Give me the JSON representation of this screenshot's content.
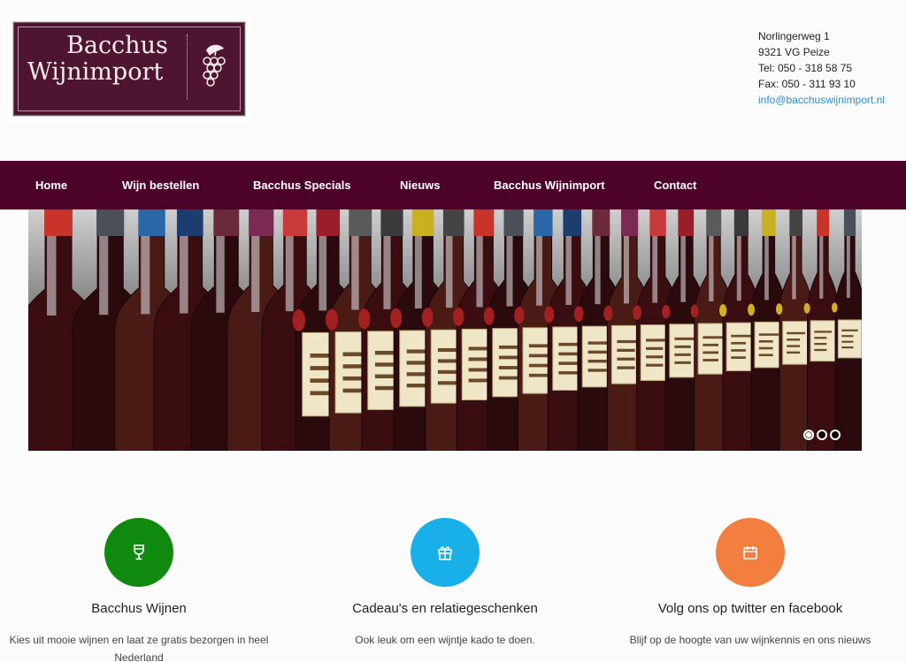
{
  "header": {
    "logo": {
      "line1": "Bacchus",
      "line2": "Wijnimport",
      "bg_color": "#4f1530"
    },
    "contact": {
      "street": "Norlingerweg 1",
      "city": "9321 VG Peize",
      "tel": "Tel: 050 - 318 58 75",
      "fax": "Fax: 050 - 311 93 10",
      "email": "info@bacchuswijnimport.nl"
    }
  },
  "nav": {
    "bg_color": "#4c0229",
    "items": [
      {
        "label": "Home"
      },
      {
        "label": "Wijn bestellen"
      },
      {
        "label": "Bacchus Specials"
      },
      {
        "label": "Nieuws"
      },
      {
        "label": "Bacchus Wijnimport"
      },
      {
        "label": "Contact"
      }
    ]
  },
  "slider": {
    "image_subject": "row of wine bottles with labels",
    "slide_count": 3,
    "active_slide": 1
  },
  "features": [
    {
      "title": "Bacchus Wijnen",
      "text": "Kies uit mooie wijnen en laat ze gratis bezorgen in heel Nederland",
      "icon": "wine-glass-icon",
      "color": "#0f8a0f"
    },
    {
      "title": "Cadeau's en relatiegeschenken",
      "text": "Ook leuk om een wijntje kado te doen.",
      "icon": "gift-icon",
      "color": "#19b0ea"
    },
    {
      "title": "Volg ons op twitter en facebook",
      "text": "Blijf op de hoogte van uw wijnkennis en ons nieuws",
      "icon": "calendar-icon",
      "color": "#f27f40"
    }
  ]
}
